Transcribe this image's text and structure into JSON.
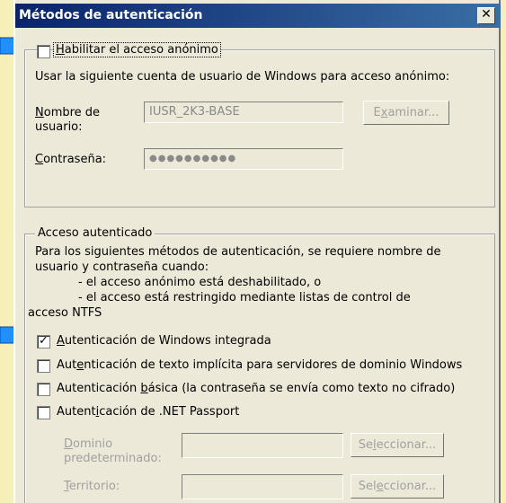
{
  "window": {
    "title": "Métodos de autenticación",
    "close_glyph": "✕"
  },
  "anon": {
    "legend_pre": "",
    "legend_key": "H",
    "legend_rest": "abilitar el acceso anónimo",
    "checked": false,
    "desc": "Usar la siguiente cuenta de usuario de Windows para acceso anónimo:",
    "user_label_key": "N",
    "user_label_rest1": "ombre de",
    "user_label_rest2": "usuario:",
    "user_value": "IUSR_2K3-BASE",
    "browse_pre": "E",
    "browse_key": "x",
    "browse_rest": "aminar...",
    "pass_label_key": "C",
    "pass_label_rest": "ontraseña:",
    "pass_value": "●●●●●●●●●●"
  },
  "auth": {
    "legend": "Acceso autenticado",
    "desc_line1": "Para los siguientes métodos de autenticación, se requiere nombre de",
    "desc_line2": "usuario y contraseña cuando:",
    "desc_line3": "- el acceso anónimo está deshabilitado, o",
    "desc_line4": "- el acceso está restringido mediante listas de control de",
    "desc_line5": "acceso NTFS",
    "options": [
      {
        "pre": "",
        "key": "A",
        "rest": "utenticación de Windows integrada",
        "checked": true
      },
      {
        "pre": "Aut",
        "key": "e",
        "rest": "nticación de texto implícita para servidores de dominio Windows",
        "checked": false
      },
      {
        "pre": "Autenticación ",
        "key": "b",
        "rest": "ásica (la contraseña se envía como texto no cifrado)",
        "checked": false
      },
      {
        "pre": "Autent",
        "key": "i",
        "rest": "cación de .NET Passport",
        "checked": false
      }
    ],
    "domain_label_key": "D",
    "domain_label_rest1": "ominio",
    "domain_label_rest2": "predeterminado:",
    "select1_pre": "Se",
    "select1_key": "l",
    "select1_rest": "eccionar...",
    "realm_label_key": "T",
    "realm_label_rest": "erritorio:",
    "select2_pre": "Sel",
    "select2_key": "e",
    "select2_rest": "ccionar..."
  },
  "colors": {
    "arrow": "#1e90ff",
    "background": "#f6efb8",
    "titlebar": "#0a246a"
  }
}
